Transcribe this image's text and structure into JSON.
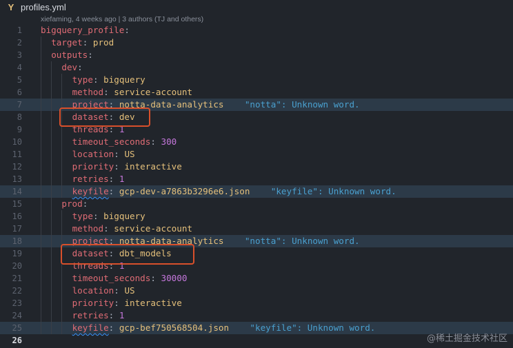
{
  "tab": {
    "icon": "yaml-file-icon",
    "glyph": "Y",
    "filename": "profiles.yml"
  },
  "blame": "xiefaming, 4 weeks ago | 3 authors (TJ and others)",
  "watermark": "@稀土掘金技术社区",
  "colors": {
    "background": "#21252b",
    "key": "#e06c75",
    "value": "#e5c07b",
    "number": "#c678dd",
    "diagnostic": "#4aa0cf",
    "highlight_box": "#d9502b"
  },
  "lines": [
    {
      "n": "1",
      "indent": 0,
      "tokens": [
        {
          "t": "bigquery_profile",
          "c": "key"
        },
        {
          "t": ":",
          "c": "punc"
        }
      ]
    },
    {
      "n": "2",
      "indent": 1,
      "tokens": [
        {
          "t": "target",
          "c": "key"
        },
        {
          "t": ": ",
          "c": "punc"
        },
        {
          "t": "prod",
          "c": "val"
        }
      ]
    },
    {
      "n": "3",
      "indent": 1,
      "tokens": [
        {
          "t": "outputs",
          "c": "key"
        },
        {
          "t": ":",
          "c": "punc"
        }
      ]
    },
    {
      "n": "4",
      "indent": 2,
      "tokens": [
        {
          "t": "dev",
          "c": "key"
        },
        {
          "t": ":",
          "c": "punc"
        }
      ]
    },
    {
      "n": "5",
      "indent": 3,
      "tokens": [
        {
          "t": "type",
          "c": "key"
        },
        {
          "t": ": ",
          "c": "punc"
        },
        {
          "t": "bigquery",
          "c": "val"
        }
      ]
    },
    {
      "n": "6",
      "indent": 3,
      "tokens": [
        {
          "t": "method",
          "c": "key"
        },
        {
          "t": ": ",
          "c": "punc"
        },
        {
          "t": "service-account",
          "c": "val"
        }
      ]
    },
    {
      "n": "7",
      "indent": 3,
      "hl": true,
      "tokens": [
        {
          "t": "project",
          "c": "key"
        },
        {
          "t": ": ",
          "c": "punc"
        },
        {
          "t": "notta-data-analytics",
          "c": "val"
        },
        {
          "t": "    \"notta\": Unknown word.",
          "c": "err"
        }
      ]
    },
    {
      "n": "8",
      "indent": 3,
      "tokens": [
        {
          "t": "dataset",
          "c": "key"
        },
        {
          "t": ": ",
          "c": "punc"
        },
        {
          "t": "dev",
          "c": "val"
        }
      ]
    },
    {
      "n": "9",
      "indent": 3,
      "tokens": [
        {
          "t": "threads",
          "c": "key"
        },
        {
          "t": ": ",
          "c": "punc"
        },
        {
          "t": "1",
          "c": "num"
        }
      ]
    },
    {
      "n": "10",
      "indent": 3,
      "tokens": [
        {
          "t": "timeout_seconds",
          "c": "key"
        },
        {
          "t": ": ",
          "c": "punc"
        },
        {
          "t": "300",
          "c": "num"
        }
      ]
    },
    {
      "n": "11",
      "indent": 3,
      "tokens": [
        {
          "t": "location",
          "c": "key"
        },
        {
          "t": ": ",
          "c": "punc"
        },
        {
          "t": "US",
          "c": "val"
        }
      ]
    },
    {
      "n": "12",
      "indent": 3,
      "tokens": [
        {
          "t": "priority",
          "c": "key"
        },
        {
          "t": ": ",
          "c": "punc"
        },
        {
          "t": "interactive",
          "c": "val"
        }
      ]
    },
    {
      "n": "13",
      "indent": 3,
      "tokens": [
        {
          "t": "retries",
          "c": "key"
        },
        {
          "t": ": ",
          "c": "punc"
        },
        {
          "t": "1",
          "c": "num"
        }
      ]
    },
    {
      "n": "14",
      "indent": 3,
      "hl": true,
      "tokens": [
        {
          "t": "keyfile",
          "c": "key squig"
        },
        {
          "t": ": ",
          "c": "punc"
        },
        {
          "t": "gcp-dev-a7863b3296e6.json",
          "c": "val"
        },
        {
          "t": "    \"keyfile\": Unknown word.",
          "c": "err"
        }
      ]
    },
    {
      "n": "15",
      "indent": 2,
      "tokens": [
        {
          "t": "prod",
          "c": "key"
        },
        {
          "t": ":",
          "c": "punc"
        }
      ]
    },
    {
      "n": "16",
      "indent": 3,
      "tokens": [
        {
          "t": "type",
          "c": "key"
        },
        {
          "t": ": ",
          "c": "punc"
        },
        {
          "t": "bigquery",
          "c": "val"
        }
      ]
    },
    {
      "n": "17",
      "indent": 3,
      "tokens": [
        {
          "t": "method",
          "c": "key"
        },
        {
          "t": ": ",
          "c": "punc"
        },
        {
          "t": "service-account",
          "c": "val"
        }
      ]
    },
    {
      "n": "18",
      "indent": 3,
      "hl": true,
      "tokens": [
        {
          "t": "project",
          "c": "key"
        },
        {
          "t": ": ",
          "c": "punc"
        },
        {
          "t": "notta-data-analytics",
          "c": "val"
        },
        {
          "t": "    \"notta\": Unknown word.",
          "c": "err"
        }
      ]
    },
    {
      "n": "19",
      "indent": 3,
      "tokens": [
        {
          "t": "dataset",
          "c": "key"
        },
        {
          "t": ": ",
          "c": "punc"
        },
        {
          "t": "dbt_models",
          "c": "val"
        }
      ]
    },
    {
      "n": "20",
      "indent": 3,
      "tokens": [
        {
          "t": "threads",
          "c": "key"
        },
        {
          "t": ": ",
          "c": "punc"
        },
        {
          "t": "1",
          "c": "num"
        }
      ]
    },
    {
      "n": "21",
      "indent": 3,
      "tokens": [
        {
          "t": "timeout_seconds",
          "c": "key"
        },
        {
          "t": ": ",
          "c": "punc"
        },
        {
          "t": "30000",
          "c": "num"
        }
      ]
    },
    {
      "n": "22",
      "indent": 3,
      "tokens": [
        {
          "t": "location",
          "c": "key"
        },
        {
          "t": ": ",
          "c": "punc"
        },
        {
          "t": "US",
          "c": "val"
        }
      ]
    },
    {
      "n": "23",
      "indent": 3,
      "tokens": [
        {
          "t": "priority",
          "c": "key"
        },
        {
          "t": ": ",
          "c": "punc"
        },
        {
          "t": "interactive",
          "c": "val"
        }
      ]
    },
    {
      "n": "24",
      "indent": 3,
      "tokens": [
        {
          "t": "retries",
          "c": "key"
        },
        {
          "t": ": ",
          "c": "punc"
        },
        {
          "t": "1",
          "c": "num"
        }
      ]
    },
    {
      "n": "25",
      "indent": 3,
      "hl": true,
      "tokens": [
        {
          "t": "keyfile",
          "c": "key squig"
        },
        {
          "t": ": ",
          "c": "punc"
        },
        {
          "t": "gcp-bef750568504.json",
          "c": "val"
        },
        {
          "t": "    \"keyfile\": Unknown word.",
          "c": "err"
        }
      ]
    },
    {
      "n": "26",
      "indent": 0,
      "current": true,
      "tokens": []
    }
  ]
}
